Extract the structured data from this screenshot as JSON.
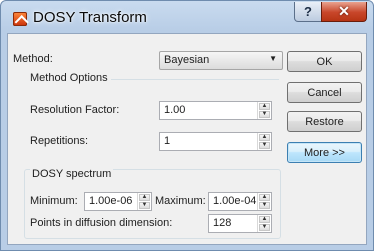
{
  "window": {
    "title": "DOSY Transform",
    "help_glyph": "?",
    "close_glyph": "✕"
  },
  "method": {
    "label": "Method:",
    "value": "Bayesian",
    "arrow": "▼"
  },
  "method_options": {
    "title": "Method Options",
    "resolution_label": "Resolution Factor:",
    "resolution_value": "1.00",
    "repetitions_label": "Repetitions:",
    "repetitions_value": "1"
  },
  "dosy_spectrum": {
    "title": "DOSY spectrum",
    "minimum_label": "Minimum:",
    "minimum_value": "1.00e-06",
    "maximum_label": "Maximum:",
    "maximum_value": "1.00e-04",
    "points_label": "Points in diffusion dimension:",
    "points_value": "128"
  },
  "buttons": {
    "ok": "OK",
    "cancel": "Cancel",
    "restore": "Restore",
    "more": "More >>"
  },
  "spin_glyphs": {
    "up": "▲",
    "down": "▼"
  }
}
